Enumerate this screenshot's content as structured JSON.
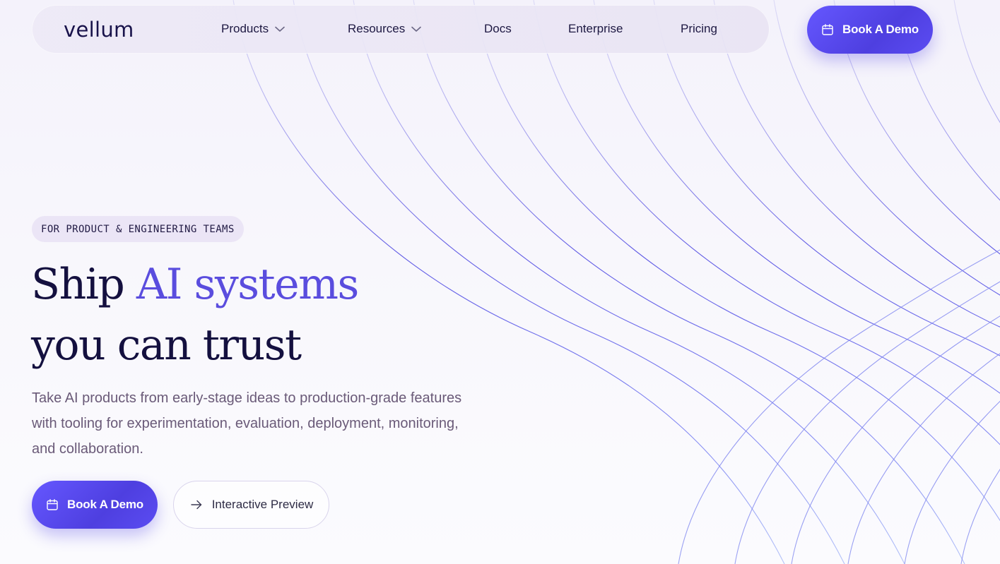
{
  "header": {
    "logo": "vellum",
    "nav": [
      {
        "label": "Products",
        "has_dropdown": true
      },
      {
        "label": "Resources",
        "has_dropdown": true
      },
      {
        "label": "Docs",
        "has_dropdown": false
      },
      {
        "label": "Enterprise",
        "has_dropdown": false
      },
      {
        "label": "Pricing",
        "has_dropdown": false
      }
    ],
    "cta_label": "Book A Demo",
    "cta_icon": "calendar-icon"
  },
  "hero": {
    "badge": "FOR PRODUCT & ENGINEERING TEAMS",
    "headline_part1": "Ship ",
    "headline_accent": "AI systems",
    "headline_line2": "you can trust",
    "subtext": "Take AI products from early-stage ideas to production-grade features with tooling for experimentation, evaluation, deployment, monitoring, and collaboration.",
    "primary_cta": "Book A Demo",
    "primary_cta_icon": "calendar-icon",
    "secondary_cta": "Interactive Preview",
    "secondary_cta_icon": "arrow-right-icon"
  },
  "colors": {
    "accent": "#5a4dde",
    "button": "#5b4cf2",
    "heading": "#14103f",
    "body_text": "#6a5a78",
    "lines": "#5b5be8"
  }
}
